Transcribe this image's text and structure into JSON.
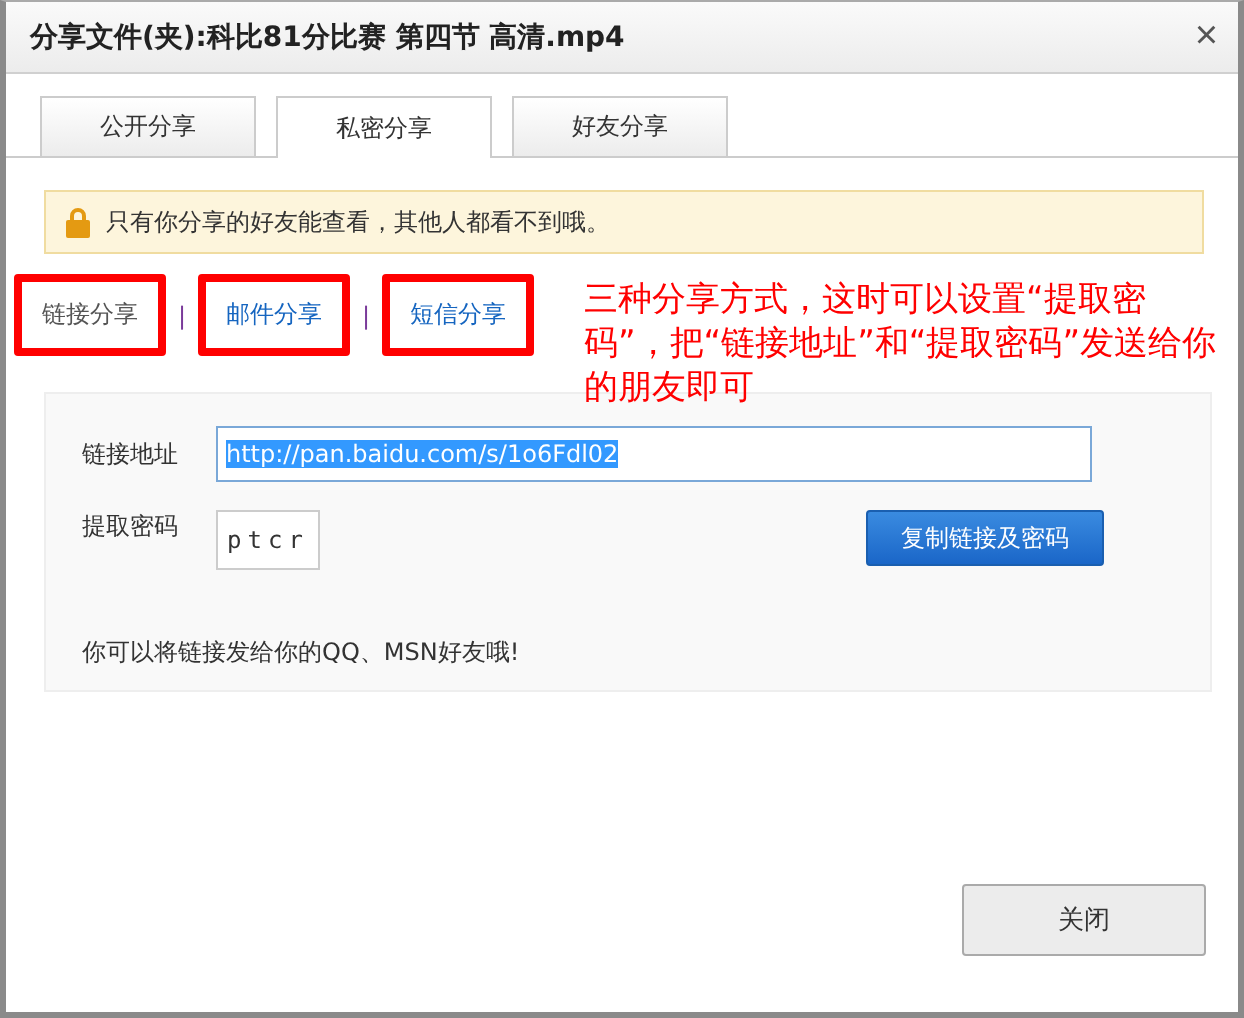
{
  "window": {
    "title": "分享文件(夹):科比81分比赛 第四节 高清.mp4",
    "close": "×"
  },
  "tabs": [
    {
      "label": "公开分享",
      "selected": false
    },
    {
      "label": "私密分享",
      "selected": true
    },
    {
      "label": "好友分享",
      "selected": false
    }
  ],
  "notice": "只有你分享的好友能查看，其他人都看不到哦。",
  "methods": [
    {
      "label": "链接分享",
      "selected": true,
      "highlighted": true
    },
    {
      "label": "邮件分享",
      "selected": false,
      "highlighted": true
    },
    {
      "label": "短信分享",
      "selected": false,
      "highlighted": true
    }
  ],
  "separator": "|",
  "annotation": "三种分享方式，这时可以设置“提取密码”，把“链接地址”和“提取密码”发送给你的朋友即可",
  "link": {
    "label": "链接地址",
    "value": "http://pan.baidu.com/s/1o6Fdl02",
    "selected": true
  },
  "password": {
    "label": "提取密码",
    "value": "ptcr"
  },
  "copy_button": "复制链接及密码",
  "hint": "你可以将链接发给你的QQ、MSN好友哦!",
  "close_button": "关闭"
}
